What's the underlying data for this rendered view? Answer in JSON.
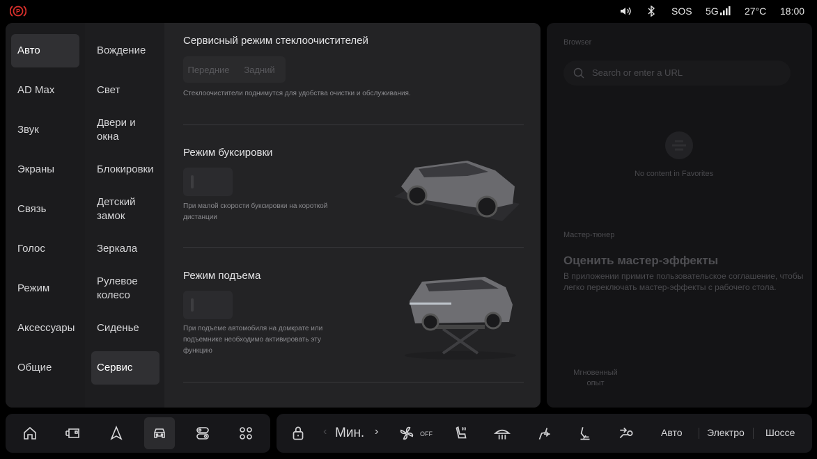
{
  "status": {
    "sos": "SOS",
    "network": "5G",
    "temperature": "27°C",
    "time": "18:00"
  },
  "nav_primary": [
    "Авто",
    "AD Max",
    "Звук",
    "Экраны",
    "Связь",
    "Голос",
    "Режим",
    "Аксессуары",
    "Общие"
  ],
  "nav_secondary": [
    "Вождение",
    "Свет",
    "Двери и окна",
    "Блокировки",
    "Детский замок",
    "Зеркала",
    "Рулевое колесо",
    "Сиденье",
    "Сервис"
  ],
  "content": {
    "wiper_title": "Сервисный режим стеклоочистителей",
    "wiper_front": "Передние",
    "wiper_rear": "Задний",
    "wiper_desc": "Стеклоочистители поднимутся для удобства очистки и обслуживания.",
    "tow_title": "Режим буксировки",
    "tow_desc": "При малой скорости буксировки на короткой дистанции",
    "lift_title": "Режим подъема",
    "lift_desc": "При подъеме автомобиля на домкрате или подъемнике необходимо активировать эту функцию"
  },
  "right_panel": {
    "browser_label": "Browser",
    "search_placeholder": "Search or enter a URL",
    "no_content": "No content in Favorites",
    "tuner_label": "Мастер-тюнер",
    "tuner_title": "Оценить мастер-эффекты",
    "tuner_desc": "В приложении примите пользовательское соглашение, чтобы легко переключать мастер-эффекты с рабочего стола.",
    "instant_label": "Мгновенный опыт"
  },
  "bottom": {
    "fan_level": "Мин.",
    "fan_state": "OFF",
    "modes": [
      "Авто",
      "Электро",
      "Шоссе"
    ]
  },
  "colors": {
    "parking_brake": "#d9302c",
    "panel": "#1f1f21",
    "selected": "#303033"
  }
}
